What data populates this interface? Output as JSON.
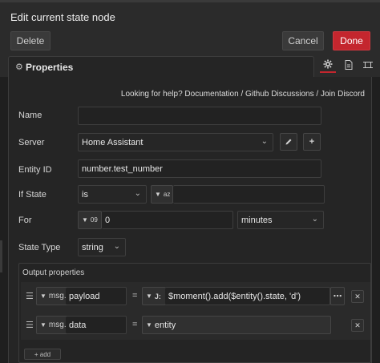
{
  "dialog": {
    "title": "Edit current state node",
    "delete_label": "Delete",
    "cancel_label": "Cancel",
    "done_label": "Done",
    "accent_color": "#c4262e"
  },
  "tabs": {
    "properties_label": "Properties",
    "icons": [
      "gear-icon",
      "document-icon",
      "frame-icon"
    ]
  },
  "help": {
    "prefix": "Looking for help?",
    "links": [
      "Documentation",
      "Github Discussions",
      "Join Discord"
    ]
  },
  "form": {
    "name_label": "Name",
    "name_value": "",
    "server_label": "Server",
    "server_value": "Home Assistant",
    "entity_id_label": "Entity ID",
    "entity_id_value": "number.test_number",
    "if_state_label": "If State",
    "if_state_operator": "is",
    "if_state_type_icon": "az",
    "if_state_value": "",
    "for_label": "For",
    "for_type_icon": "09",
    "for_value": "0",
    "for_unit": "minutes",
    "state_type_label": "State Type",
    "state_type_value": "string"
  },
  "output": {
    "header": "Output properties",
    "rows": [
      {
        "type_label": "msg.",
        "property": "payload",
        "value_type_icon": "J:",
        "value": "$moment().add($entity().state, 'd')"
      },
      {
        "type_label": "msg.",
        "property": "data",
        "value_type_icon": "",
        "value": "entity"
      }
    ],
    "add_label": "+ add"
  }
}
